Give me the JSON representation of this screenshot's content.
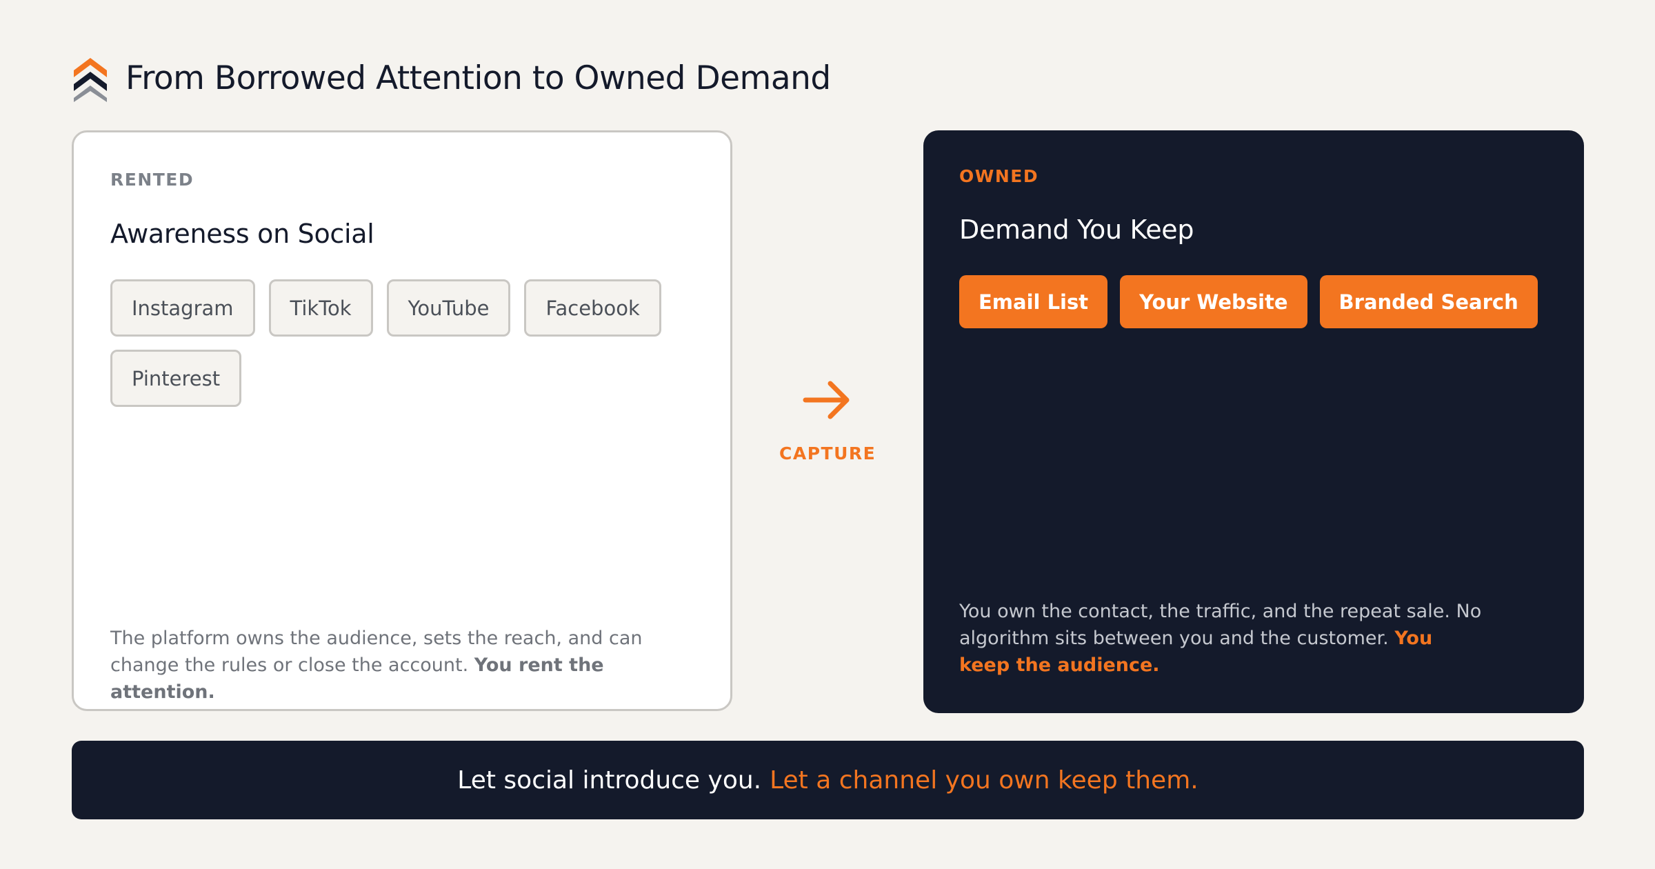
{
  "page": {
    "title": "From Borrowed Attention to Owned Demand"
  },
  "rented": {
    "eyebrow": "RENTED",
    "title": "Awareness on Social",
    "chips": [
      "Instagram",
      "TikTok",
      "YouTube",
      "Facebook",
      "Pinterest"
    ],
    "description": "The platform owns the audience, sets the reach, and can change the rules or close the account.",
    "description_strong": "You rent the attention."
  },
  "connector": {
    "label": "CAPTURE",
    "icon": "arrow-right-icon"
  },
  "owned": {
    "eyebrow": "OWNED",
    "title": "Demand You Keep",
    "chips": [
      "Email List",
      "Your Website",
      "Branded Search"
    ],
    "description": "You own the contact, the traffic, and the repeat sale. No algorithm sits between you and the customer.",
    "description_strong": "You keep the audience."
  },
  "banner": {
    "lead": "Let social introduce you.",
    "accent": "Let a channel you own keep them."
  },
  "colors": {
    "accent": "#f37520",
    "navy": "#141a2b",
    "background": "#f5f3ef"
  }
}
